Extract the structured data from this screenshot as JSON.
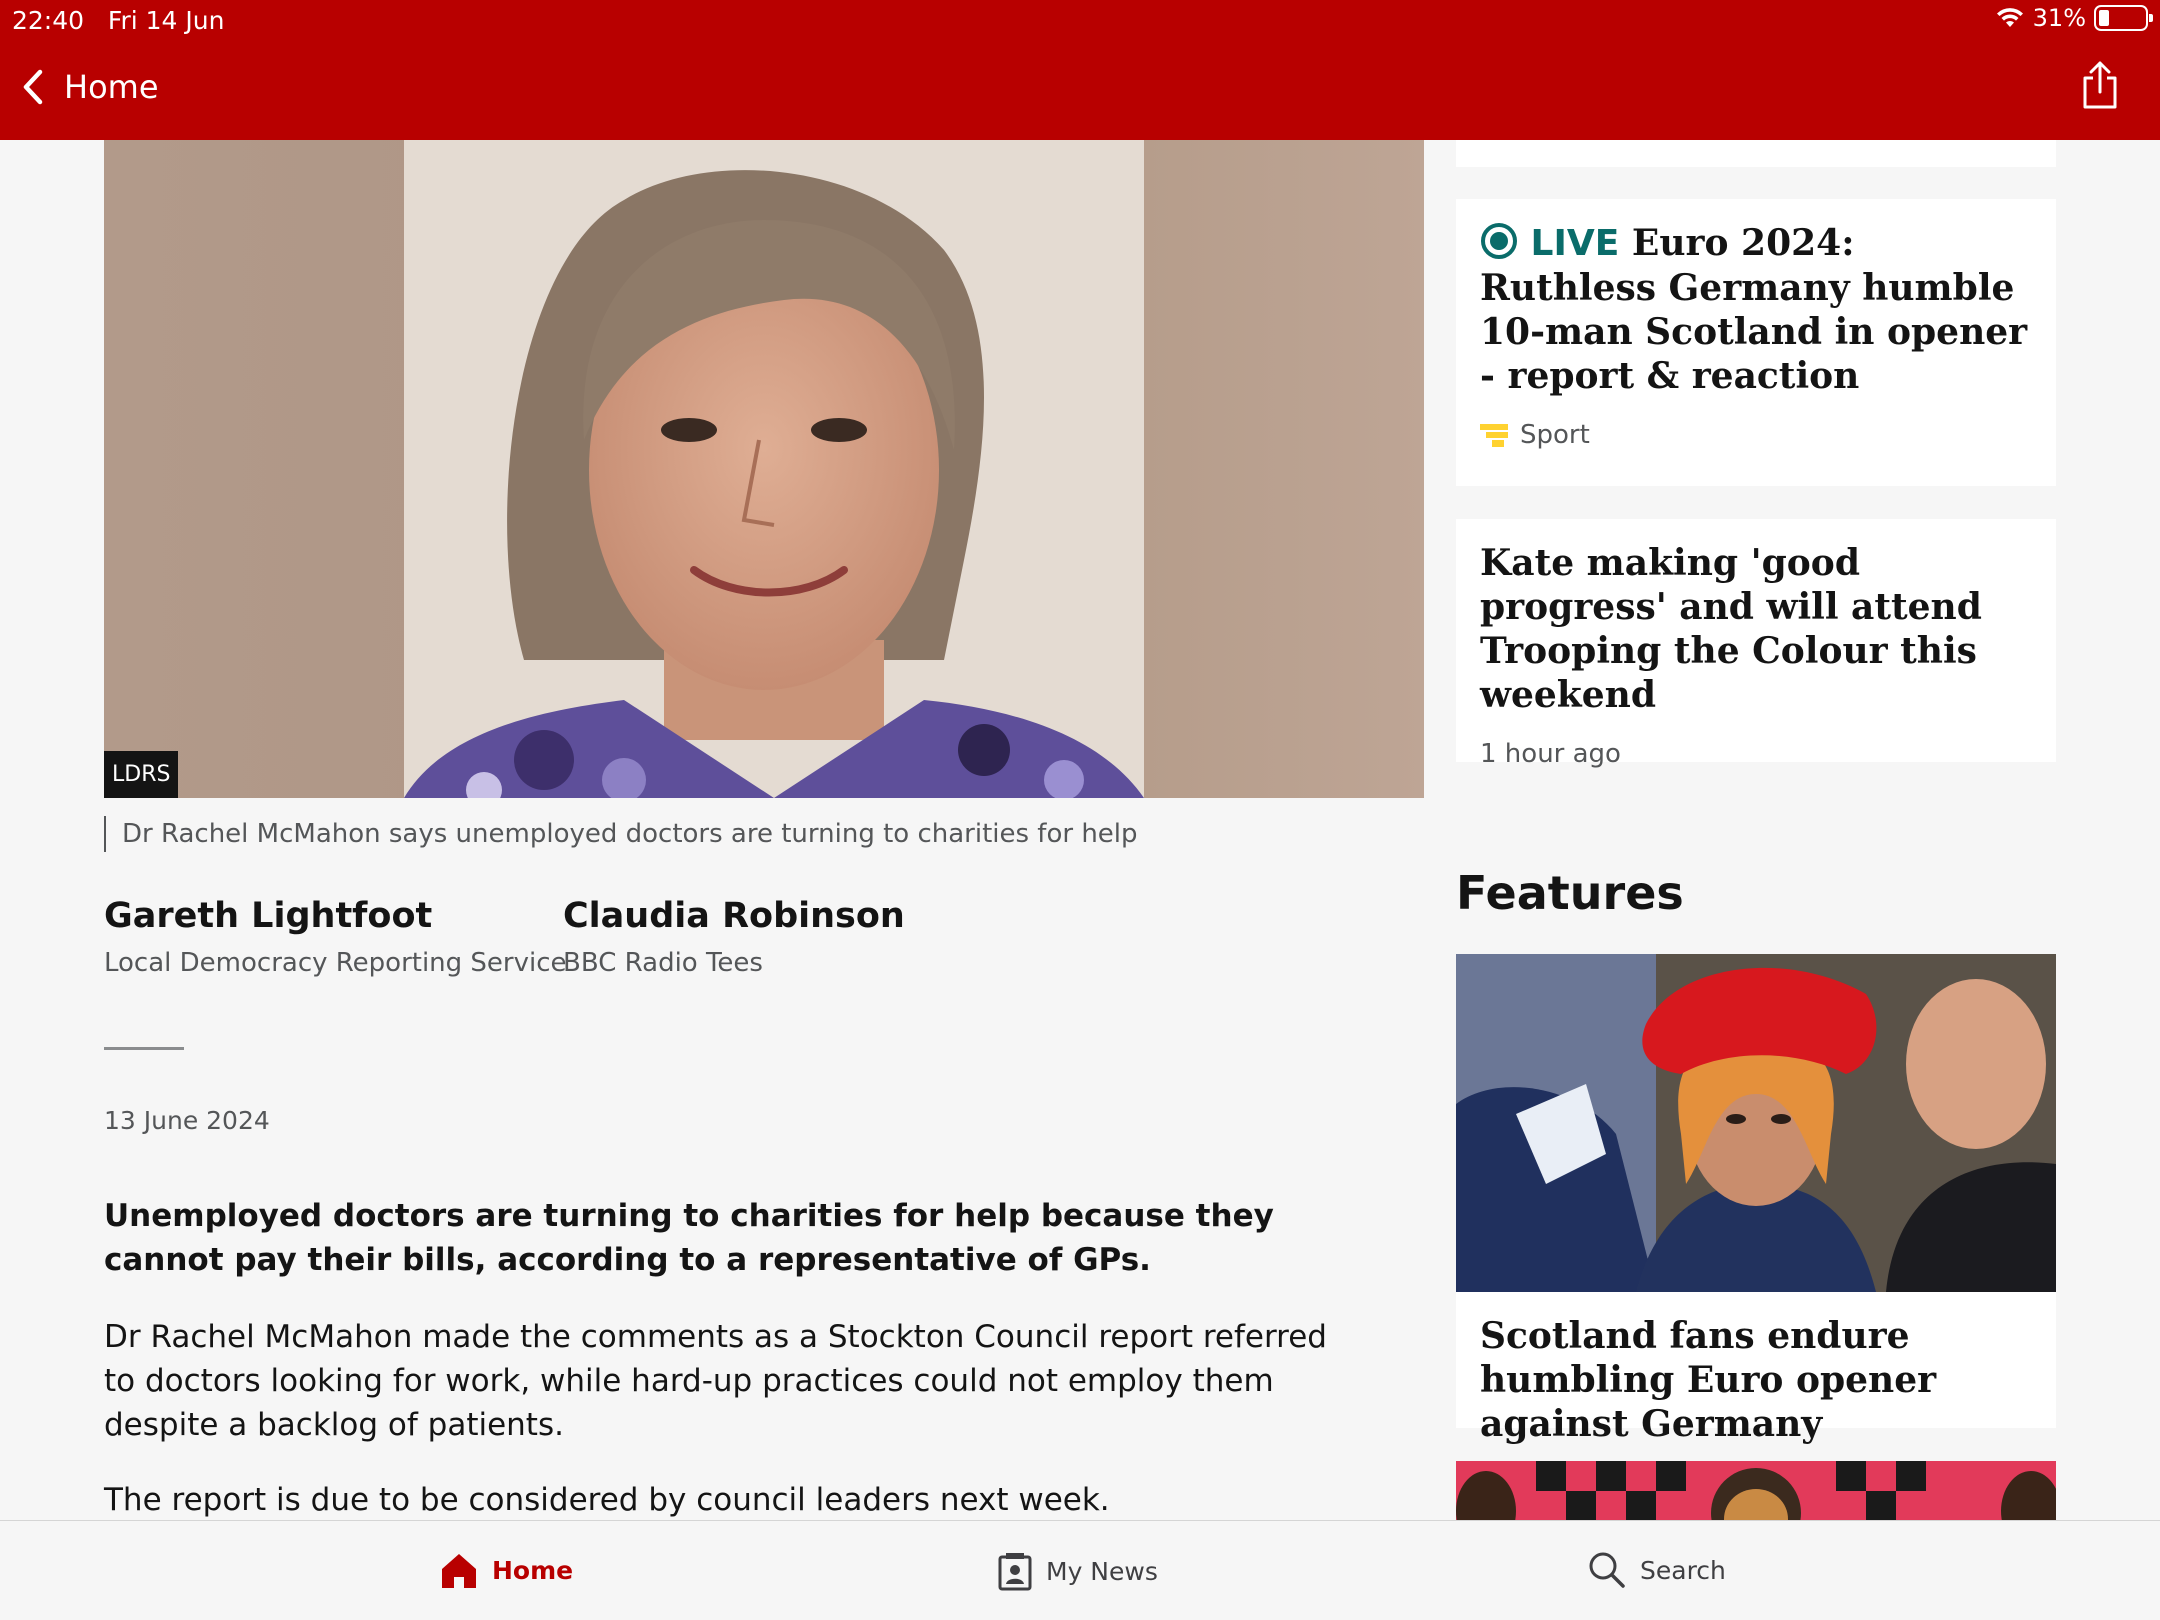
{
  "status": {
    "time": "22:40",
    "date": "Fri 14 Jun",
    "battery": "31%"
  },
  "header": {
    "back_label": "Home"
  },
  "hero": {
    "credit": "LDRS",
    "caption": "Dr Rachel McMahon says unemployed doctors are turning to charities for help"
  },
  "authors": [
    {
      "name": "Gareth Lightfoot",
      "org": "Local Democracy Reporting Service"
    },
    {
      "name": "Claudia Robinson",
      "org": "BBC Radio Tees"
    }
  ],
  "article": {
    "date": "13 June 2024",
    "lead": "Unemployed doctors are turning to charities for help because they cannot pay their bills, according to a representative of GPs.",
    "paragraphs": [
      "Dr Rachel McMahon made the comments as a Stockton Council report referred to doctors looking for work, while hard-up practices could not employ them despite a backlog of patients.",
      "The report is due to be considered by council leaders next week."
    ]
  },
  "sidebar": {
    "live_card": {
      "live_label": "LIVE",
      "title": "Euro 2024: Ruthless Germany humble 10-man Scotland in opener - report & reaction",
      "section": "Sport"
    },
    "kate_card": {
      "title": "Kate making 'good progress' and will attend Trooping the Colour this weekend",
      "time": "1 hour ago"
    },
    "features_heading": "Features",
    "feature_card": {
      "title": "Scotland fans endure humbling Euro opener against Germany"
    }
  },
  "tabs": [
    {
      "label": "Home",
      "active": true
    },
    {
      "label": "My News",
      "active": false
    },
    {
      "label": "Search",
      "active": false
    }
  ],
  "colors": {
    "brand_red": "#b80000",
    "live_teal": "#0a6c6a",
    "sport_yellow": "#ffd230"
  }
}
